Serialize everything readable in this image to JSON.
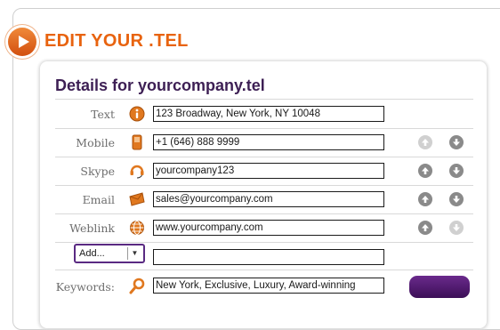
{
  "page": {
    "title": "EDIT YOUR .TEL"
  },
  "details": {
    "title": "Details for yourcompany.tel",
    "rows": [
      {
        "label": "Text",
        "value": "123 Broadway, New York, NY 10048",
        "icon": "info-icon"
      },
      {
        "label": "Mobile",
        "value": "+1 (646) 888 9999",
        "icon": "mobile-phone-icon",
        "up_enabled": false,
        "down_enabled": true
      },
      {
        "label": "Skype",
        "value": "yourcompany123",
        "icon": "skype-headset-icon",
        "up_enabled": true,
        "down_enabled": true
      },
      {
        "label": "Email",
        "value": "sales@yourcompany.com",
        "icon": "envelope-icon",
        "up_enabled": true,
        "down_enabled": true
      },
      {
        "label": "Weblink",
        "value": "www.yourcompany.com",
        "icon": "globe-icon",
        "up_enabled": true,
        "down_enabled": false
      }
    ],
    "add": {
      "select_value": "Add...",
      "input_value": ""
    },
    "keywords": {
      "label": "Keywords:",
      "value": "New York, Exclusive, Luxury, Award-winning",
      "icon": "magnifier-icon"
    }
  },
  "colors": {
    "accent": "#e8630f",
    "title": "#3d1f54",
    "button": "#4a1a6a"
  }
}
